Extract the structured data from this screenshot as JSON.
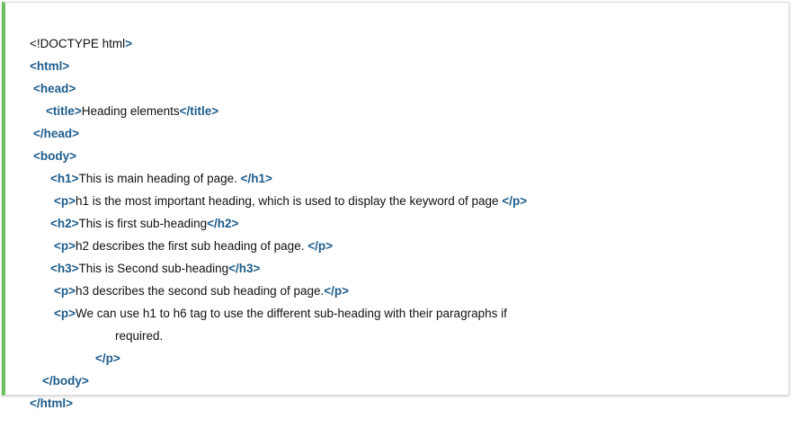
{
  "accent_color": "#6abf5e",
  "tag_color": "#1d5c8c",
  "lines": [
    {
      "pre": "<!DOCTYPE html",
      "tag": ">",
      "text": "",
      "close": ""
    },
    {
      "tag": "<html>",
      "text": "",
      "close": ""
    },
    {
      "tag": "<head>",
      "text": "",
      "close": ""
    },
    {
      "tag": "<title>",
      "text": "Heading elements",
      "close": "</title>"
    },
    {
      "tag": "</head>",
      "text": "",
      "close": ""
    },
    {
      "tag": "<body>",
      "text": "",
      "close": ""
    },
    {
      "tag": "<h1>",
      "text": "This is main heading of page. ",
      "close": "</h1>"
    },
    {
      "tag": "<p>",
      "text": "h1 is the most important heading, which is used to display the keyword of page ",
      "close": "</p>"
    },
    {
      "tag": "<h2>",
      "text": "This is first sub-heading",
      "close": "</h2>"
    },
    {
      "tag": "<p>",
      "text": "h2 describes the first sub heading of page. ",
      "close": "</p>"
    },
    {
      "tag": "<h3>",
      "text": "This is Second sub-heading",
      "close": "</h3>"
    },
    {
      "tag": "<p>",
      "text": "h3 describes the second sub heading of page.",
      "close": "</p>"
    },
    {
      "tag": "<p>",
      "text": "We can use h1 to h6 tag to use the different sub-heading with their paragraphs if",
      "close": ""
    },
    {
      "tag": "",
      "text": "required.",
      "close": ""
    },
    {
      "tag": "</p>",
      "text": "",
      "close": ""
    },
    {
      "tag": "</body>",
      "text": "",
      "close": ""
    },
    {
      "tag": "</html>",
      "text": "",
      "close": ""
    }
  ]
}
